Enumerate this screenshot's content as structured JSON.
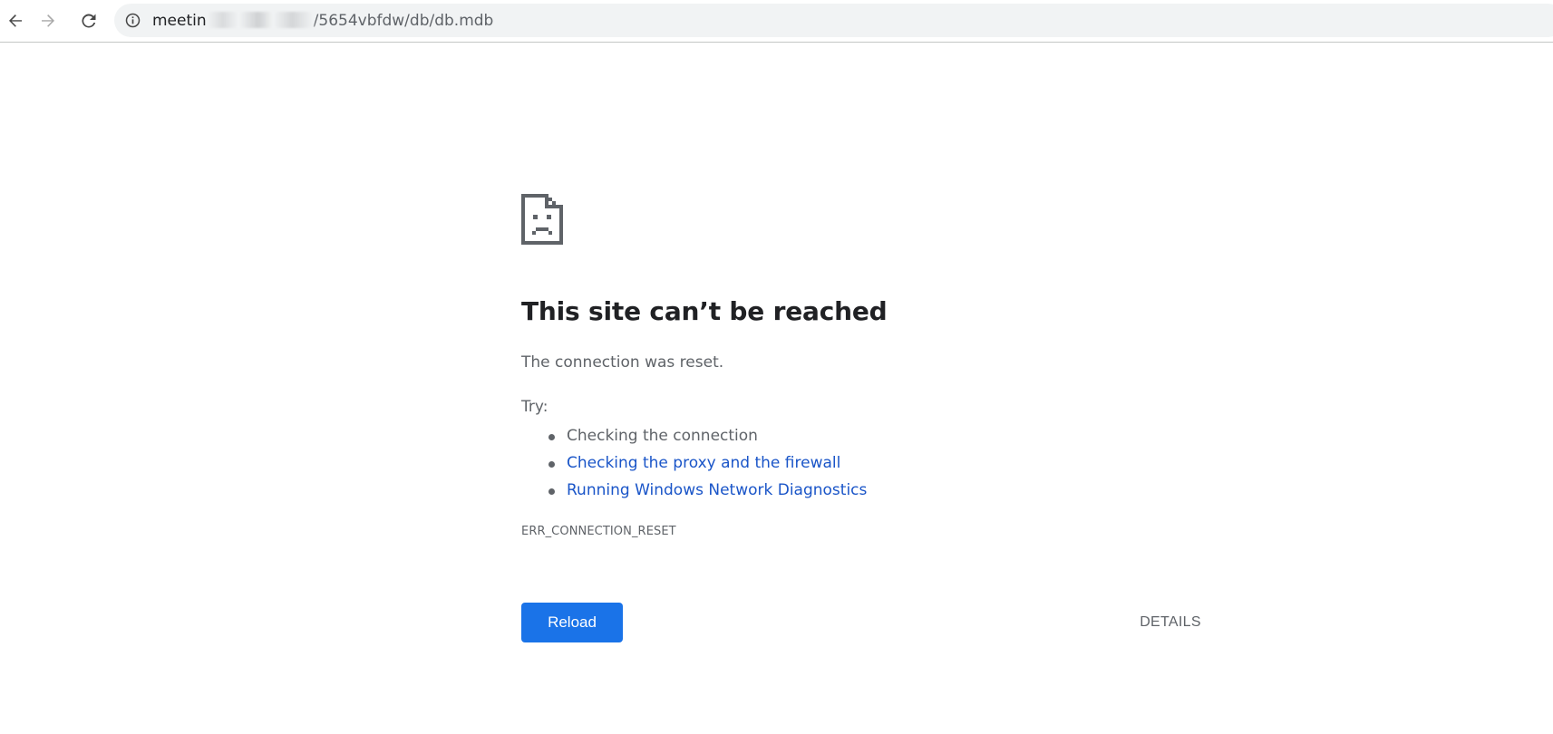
{
  "browser": {
    "back_icon": "arrow-left-icon",
    "forward_icon": "arrow-right-icon",
    "reload_icon": "reload-icon",
    "site_info_icon": "info-circle-icon",
    "url": {
      "host_visible": "meetin",
      "path_visible": "/5654vbfdw/db/db.mdb"
    }
  },
  "error_page": {
    "icon": "sad-page-icon",
    "heading": "This site can’t be reached",
    "reason": "The connection was reset.",
    "try_label": "Try:",
    "suggestions": [
      {
        "text": "Checking the connection",
        "is_link": false
      },
      {
        "text": "Checking the proxy and the firewall",
        "is_link": true
      },
      {
        "text": "Running Windows Network Diagnostics",
        "is_link": true
      }
    ],
    "error_code": "ERR_CONNECTION_RESET",
    "reload_label": "Reload",
    "details_label": "DETAILS"
  },
  "colors": {
    "link": "#1a55c8",
    "primary_button": "#1a73e8",
    "heading": "#202124",
    "body_text": "#5f6368"
  }
}
